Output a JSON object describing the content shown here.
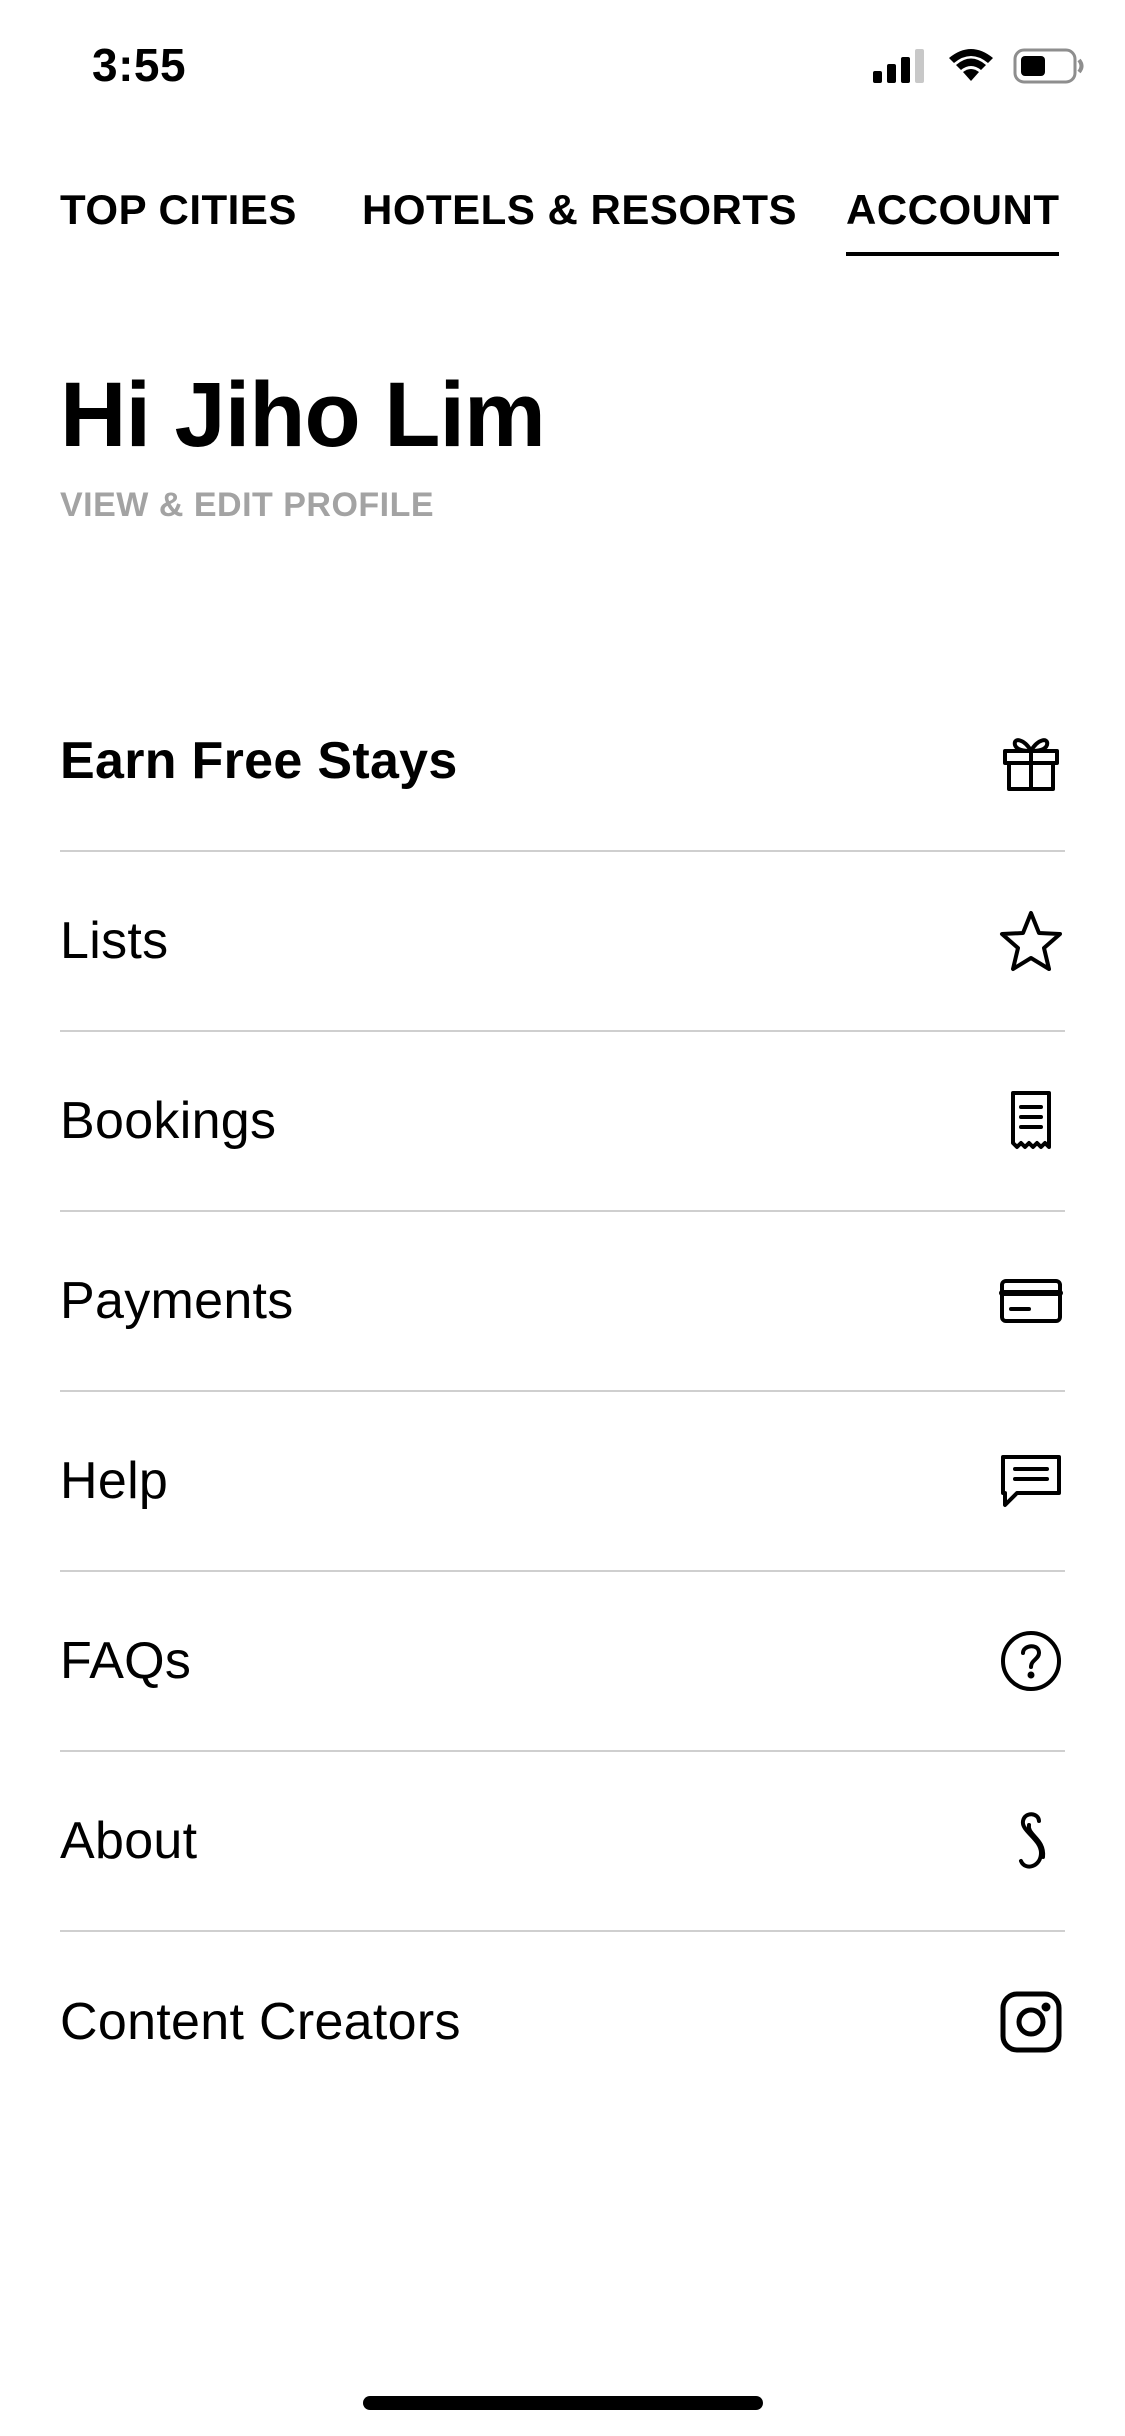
{
  "status_bar": {
    "time": "3:55"
  },
  "nav": {
    "tabs": [
      {
        "label": "TOP CITIES",
        "active": false
      },
      {
        "label": "HOTELS & RESORTS",
        "active": false
      },
      {
        "label": "ACCOUNT",
        "active": true
      }
    ]
  },
  "profile": {
    "greeting": "Hi Jiho Lim",
    "edit_link": "VIEW & EDIT PROFILE"
  },
  "menu": {
    "items": [
      {
        "label": "Earn Free Stays",
        "icon": "gift-icon"
      },
      {
        "label": "Lists",
        "icon": "star-icon"
      },
      {
        "label": "Bookings",
        "icon": "receipt-icon"
      },
      {
        "label": "Payments",
        "icon": "credit-card-icon"
      },
      {
        "label": "Help",
        "icon": "chat-bubble-icon"
      },
      {
        "label": "FAQs",
        "icon": "question-circle-icon"
      },
      {
        "label": "About",
        "icon": "brand-s-icon"
      },
      {
        "label": "Content Creators",
        "icon": "instagram-icon"
      }
    ]
  },
  "colors": {
    "text": "#000000",
    "muted": "#a3a3a3",
    "divider": "#cfcfcf",
    "background": "#ffffff"
  }
}
